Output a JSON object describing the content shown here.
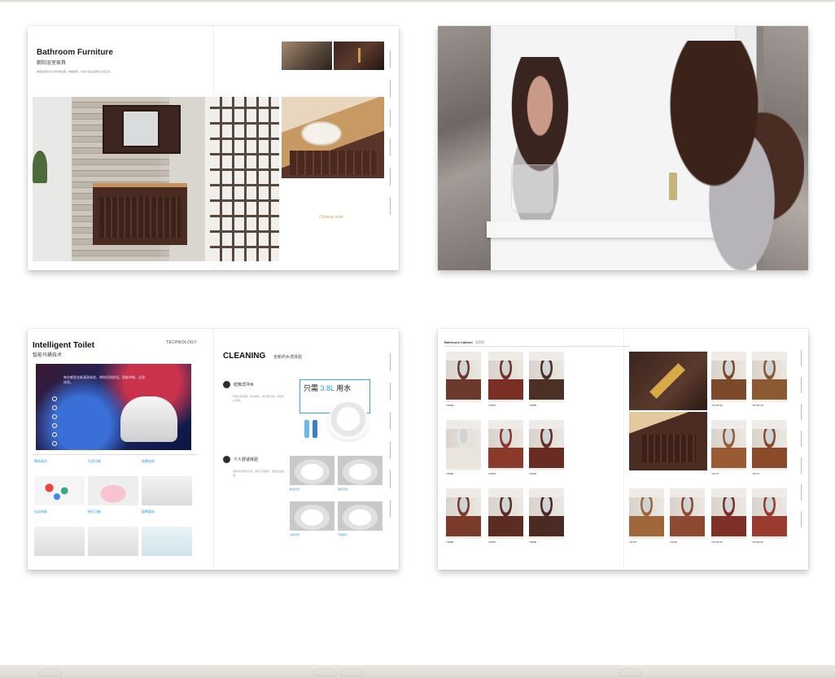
{
  "spread1": {
    "title": "Bathroom Furniture",
    "subtitle": "朝阳浴室家具",
    "description": "朝阳浴室家具系列传承经典，精雕细琢，为您打造高品质的卫浴空间。",
    "caption": "Chinese style"
  },
  "spread3": {
    "title": "Intelligent Toilet",
    "subtitle": "智能马桶技术",
    "tag": "TECHNOLOGY",
    "hero_text": "每次都是全新清洗体验，带你回到舒适。智能冲刷，洁净体验。",
    "right_title": "CLEANING",
    "right_subtitle": "全新的水洗体验",
    "feature1": {
      "label": "虹吸式冲水",
      "desc": "利用虹吸原理，冲水静音，排污能力强，有效防止异味。"
    },
    "feature2": {
      "label": "个人舒适体验",
      "desc": "多种清洗模式可选，满足不同需求，更加舒适健康。"
    },
    "callout": {
      "prefix": "只需",
      "amount": "3.8L",
      "suffix": "用水"
    },
    "cells": [
      {
        "title": "臀部清洗"
      },
      {
        "title": "妇洗功能"
      },
      {
        "title": "座圈加热"
      },
      {
        "title": "自动除臭"
      },
      {
        "title": "夜灯功能"
      },
      {
        "title": "缓降盖板"
      }
    ],
    "square_labels": [
      "移动清洗",
      "摆动清洗",
      "宽幅清洗",
      "节能模式"
    ]
  },
  "spread4": {
    "header": "Bathroom Cabinet",
    "header_cn": "浴室柜",
    "tiles": [
      {
        "code": "YD868"
      },
      {
        "code": "YD867"
      },
      {
        "code": "YD865"
      },
      {
        "code": "YD866"
      },
      {
        "code": "YD864"
      },
      {
        "code": "YD863"
      },
      {
        "code": "YD868"
      },
      {
        "code": "YD867"
      },
      {
        "code": "YD869"
      },
      {
        "code": "YD718-00"
      },
      {
        "code": "YD718-18"
      },
      {
        "code": "YD716"
      },
      {
        "code": "YD717"
      },
      {
        "code": "YD715"
      },
      {
        "code": "YD716"
      },
      {
        "code": "YD718-08"
      },
      {
        "code": "YD718-00"
      }
    ]
  }
}
